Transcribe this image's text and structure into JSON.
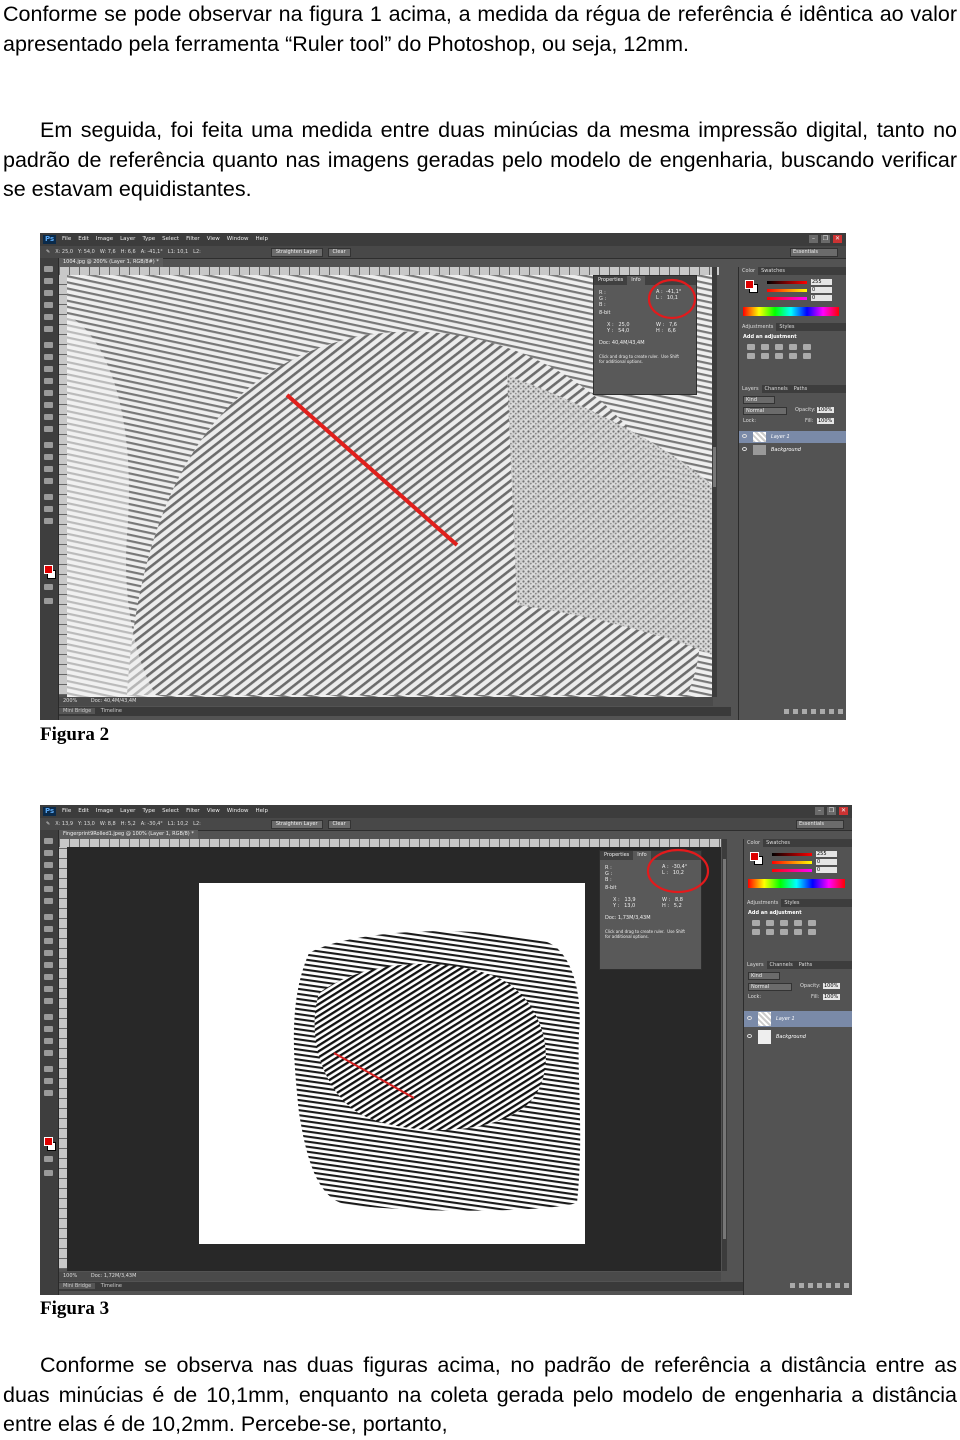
{
  "text": {
    "para1": "Conforme se pode observar na figura 1 acima, a medida da régua de referência é idêntica ao valor apresentado pela ferramenta “Ruler tool” do Photoshop, ou seja, 12mm.",
    "para2": "Em seguida, foi feita uma medida entre duas minúcias da mesma impressão digital, tanto no padrão de referência quanto nas imagens geradas pelo modelo de engenharia, buscando verificar se estavam equidistantes.",
    "caption2": "Figura 2",
    "caption3": "Figura 3",
    "para3": "Conforme se observa nas duas figuras acima, no padrão de referência a distância entre as duas minúcias é de 10,1mm, enquanto na coleta gerada pelo modelo de engenharia a distância entre elas é de 10,2mm. Percebe-se, portanto,"
  },
  "photoshop": {
    "logo": "Ps",
    "menus": [
      "File",
      "Edit",
      "Image",
      "Layer",
      "Type",
      "Select",
      "Filter",
      "View",
      "Window",
      "Help"
    ],
    "window_controls": [
      "–",
      "❐",
      "✕"
    ],
    "workspace": "Essentials",
    "straighten_button": "Straighten Layer",
    "clear_button": "Clear",
    "panel_tabs_top": [
      "Color",
      "Swatches"
    ],
    "panel_tabs_adj": [
      "Adjustments",
      "Styles"
    ],
    "add_adjustment": "Add an adjustment",
    "panel_tabs_layers": [
      "Layers",
      "Channels",
      "Paths"
    ],
    "kind_label": "Kind",
    "blend_mode": "Normal",
    "opacity_label": "Opacity:",
    "opacity_value": "100%",
    "lock_label": "Lock:",
    "fill_label": "Fill:",
    "fill_value": "100%",
    "layers": [
      "Layer 1",
      "Background"
    ],
    "props_tabs": [
      "Properties",
      "Info"
    ],
    "bit_label": "8-bit",
    "ruler_hint": "Click and drag to create ruler.  Use Shift\nfor additional options.",
    "bottom_tabs": [
      "Mini Bridge",
      "Timeline"
    ],
    "rgb_values": [
      "255",
      "0",
      "0"
    ],
    "colors": {
      "accent_red": "#d62020",
      "selected_layer": "#7a8aa8",
      "ps_blue": "#5aa7f2"
    }
  },
  "figure2": {
    "options": [
      "X: 25,0",
      "Y: 54,0",
      "W: 7,6",
      "H: 6,6",
      "A: -41,1°",
      "L1: 10,1",
      "L2:"
    ],
    "doc_tab": "1004.jpg @ 200% (Layer 1, RGB/8#) *",
    "ruler_ticks": [
      "15",
      "18",
      "21",
      "24",
      "27",
      "30",
      "33",
      "36",
      "39",
      "42",
      "45",
      "48",
      "51",
      "54"
    ],
    "info_angle": "A :  -41,1°",
    "info_length": "L :   10,1",
    "info_xy": "X :   25,0\nY :   54,0",
    "info_wh": "W :   7,6\nH :   6,6",
    "doc_size": "Doc: 40,4M/43,4M",
    "zoom": "200%",
    "status": "Doc: 40,4M/43,4M",
    "measurement_mm": 10.1
  },
  "figure3": {
    "options": [
      "X: 13,9",
      "Y: 13,0",
      "W: 8,8",
      "H: 5,2",
      "A: -30,4°",
      "L1: 10,2",
      "L2:"
    ],
    "doc_tab": "Fingerprint9Rolled1.jpeg @ 100% (Layer 1, RGB/8) *",
    "ruler_ticks": [
      "-10",
      "-5",
      "0",
      "5",
      "10",
      "15",
      "20",
      "25",
      "30",
      "35",
      "40",
      "45",
      "50",
      "55",
      "60",
      "65",
      "70"
    ],
    "info_angle": "A :  -30,4°",
    "info_length": "L :   10,2",
    "info_xy": "X :   13,9\nY :   13,0",
    "info_wh": "W :   8,8\nH :   5,2",
    "doc_size": "Doc: 1,73M/3,43M",
    "zoom": "100%",
    "status": "Doc: 1,72M/3,43M",
    "measurement_mm": 10.2
  }
}
